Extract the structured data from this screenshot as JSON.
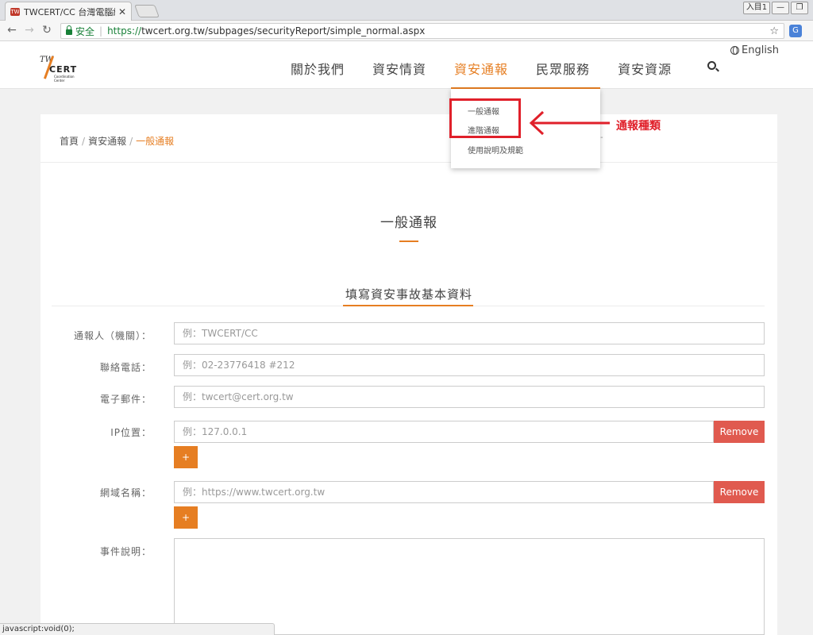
{
  "browser": {
    "tab_title": "TWCERT/CC 台灣電腦網",
    "tab_close": "✕",
    "user_label": "入目1",
    "window_controls": [
      "—",
      "❐"
    ],
    "security_label": "安全",
    "url_scheme": "https://",
    "url_rest": "twcert.org.tw/subpages/securityReport/simple_normal.aspx",
    "status_text": "javascript:void(0);"
  },
  "header": {
    "logo": {
      "tw": "TW",
      "cert": "CERT",
      "sub": "Coordination Center"
    },
    "nav": [
      {
        "label": "關於我們",
        "active": false
      },
      {
        "label": "資安情資",
        "active": false
      },
      {
        "label": "資安通報",
        "active": true
      },
      {
        "label": "民眾服務",
        "active": false
      },
      {
        "label": "資安資源",
        "active": false
      }
    ],
    "language": "English"
  },
  "dropdown": {
    "items": [
      "一般通報",
      "進階通報",
      "使用說明及規範"
    ]
  },
  "annotation": {
    "label": "通報種類"
  },
  "breadcrumb": {
    "home": "首頁",
    "parent": "資安通報",
    "current": "一般通報"
  },
  "page": {
    "title": "一般通報",
    "section_title": "填寫資安事故基本資料"
  },
  "form": {
    "reporter": {
      "label": "通報人（機關）：",
      "placeholder": "例：TWCERT/CC"
    },
    "phone": {
      "label": "聯絡電話：",
      "placeholder": "例：02-23776418 #212"
    },
    "email": {
      "label": "電子郵件：",
      "placeholder": "例：twcert@cert.org.tw"
    },
    "ip": {
      "label": "IP位置：",
      "placeholder": "例：127.0.0.1",
      "remove": "Remove",
      "add": "+"
    },
    "domain": {
      "label": "網域名稱：",
      "placeholder": "例：https://www.twcert.org.tw",
      "remove": "Remove",
      "add": "+"
    },
    "description": {
      "label": "事件說明："
    }
  },
  "colors": {
    "accent": "#e67e22",
    "remove": "#e05a4f",
    "annotation": "#e0202a",
    "secure": "#188038"
  }
}
